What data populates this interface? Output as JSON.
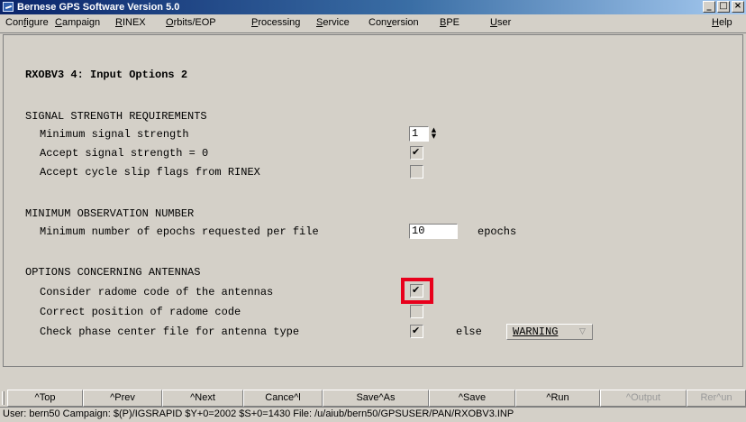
{
  "window": {
    "title": "Bernese GPS Software Version 5.0",
    "controls": {
      "minimize": "_",
      "maximize": "□",
      "close": "×"
    }
  },
  "menu": [
    {
      "pre": "Con",
      "mn": "f",
      "post": "igure"
    },
    {
      "pre": "",
      "mn": "C",
      "post": "ampaign"
    },
    {
      "pre": "",
      "mn": "R",
      "post": "INEX"
    },
    {
      "pre": "",
      "mn": "O",
      "post": "rbits/EOP"
    },
    {
      "pre": "",
      "mn": "P",
      "post": "rocessing"
    },
    {
      "pre": "",
      "mn": "S",
      "post": "ervice"
    },
    {
      "pre": "Con",
      "mn": "v",
      "post": "ersion"
    },
    {
      "pre": "",
      "mn": "B",
      "post": "PE"
    },
    {
      "pre": "",
      "mn": "U",
      "post": "ser"
    },
    {
      "pre": "",
      "mn": "H",
      "post": "elp"
    }
  ],
  "panel": {
    "title": "RXOBV3 4: Input Options 2",
    "sections": {
      "signal": {
        "header": "SIGNAL STRENGTH REQUIREMENTS",
        "min_strength": {
          "label": "Minimum signal strength",
          "value": "1"
        },
        "accept_zero": {
          "label": "Accept signal strength = 0",
          "checked": true
        },
        "accept_slip": {
          "label": "Accept cycle slip flags from RINEX",
          "checked": false
        }
      },
      "observation": {
        "header": "MINIMUM OBSERVATION NUMBER",
        "min_epochs": {
          "label": "Minimum number of epochs requested per file",
          "value": "10",
          "unit": "epochs"
        }
      },
      "antennas": {
        "header": "OPTIONS CONCERNING ANTENNAS",
        "radome_code": {
          "label": "Consider radome code of the antennas",
          "checked": true
        },
        "correct_position": {
          "label": "Correct position of radome code",
          "checked": false
        },
        "phase_center": {
          "label": "Check phase center file for antenna type",
          "checked": true,
          "else_label": "else",
          "else_value": "WARNING"
        }
      }
    }
  },
  "buttons": [
    {
      "label": "^Top",
      "enabled": true
    },
    {
      "label": "^Prev",
      "enabled": true
    },
    {
      "label": "^Next",
      "enabled": true
    },
    {
      "label": "Cance^l",
      "enabled": true
    },
    {
      "label": "Save^As",
      "enabled": true
    },
    {
      "label": "^Save",
      "enabled": true
    },
    {
      "label": "^Run",
      "enabled": true
    },
    {
      "label": "^Output",
      "enabled": false
    },
    {
      "label": "Rer^un",
      "enabled": false
    }
  ],
  "status": "User: bern50  Campaign: $(P)/IGSRAPID  $Y+0=2002  $S+0=1430  File: /u/aiub/bern50/GPSUSER/PAN/RXOBV3.INP",
  "colors": {
    "highlight": "#e8001c",
    "titlebar": "#0a246a",
    "background": "#d4d0c8"
  }
}
